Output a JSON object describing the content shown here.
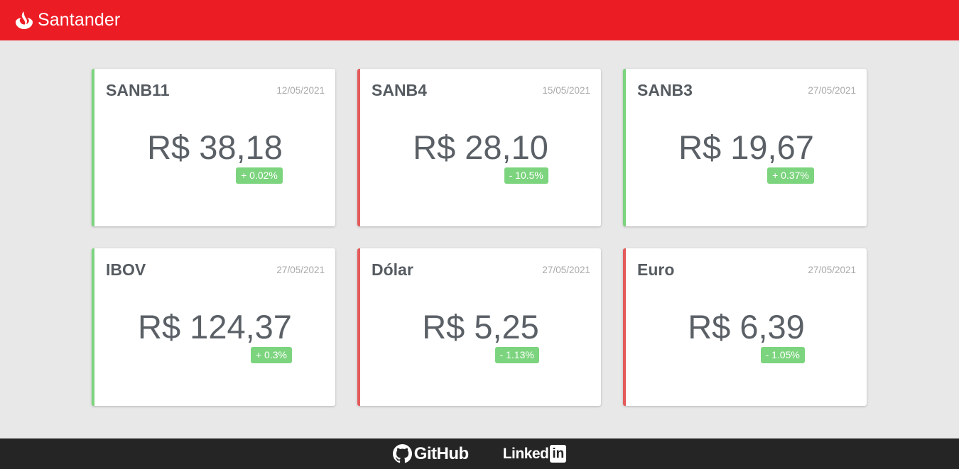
{
  "header": {
    "brand_name": "Santander",
    "brand_color": "#ec1c24",
    "logo_icon": "santander-flame-icon"
  },
  "colors": {
    "up": "#7cd47e",
    "down": "#e55a5a",
    "badge": "#7cd47e",
    "footer": "#252525"
  },
  "cards": [
    {
      "title": "SANB11",
      "date": "12/05/2021",
      "value": "R$ 38,18",
      "change": "+ 0.02%",
      "trend": "up"
    },
    {
      "title": "SANB4",
      "date": "15/05/2021",
      "value": "R$ 28,10",
      "change": "- 10.5%",
      "trend": "down"
    },
    {
      "title": "SANB3",
      "date": "27/05/2021",
      "value": "R$ 19,67",
      "change": "+ 0.37%",
      "trend": "up"
    },
    {
      "title": "IBOV",
      "date": "27/05/2021",
      "value": "R$ 124,37",
      "change": "+ 0.3%",
      "trend": "up"
    },
    {
      "title": "Dólar",
      "date": "27/05/2021",
      "value": "R$ 5,25",
      "change": "- 1.13%",
      "trend": "down"
    },
    {
      "title": "Euro",
      "date": "27/05/2021",
      "value": "R$ 6,39",
      "change": "- 1.05%",
      "trend": "down"
    }
  ],
  "footer": {
    "github_label": "GitHub",
    "github_icon": "github-icon",
    "linkedin_text": "Linked",
    "linkedin_box": "in"
  }
}
